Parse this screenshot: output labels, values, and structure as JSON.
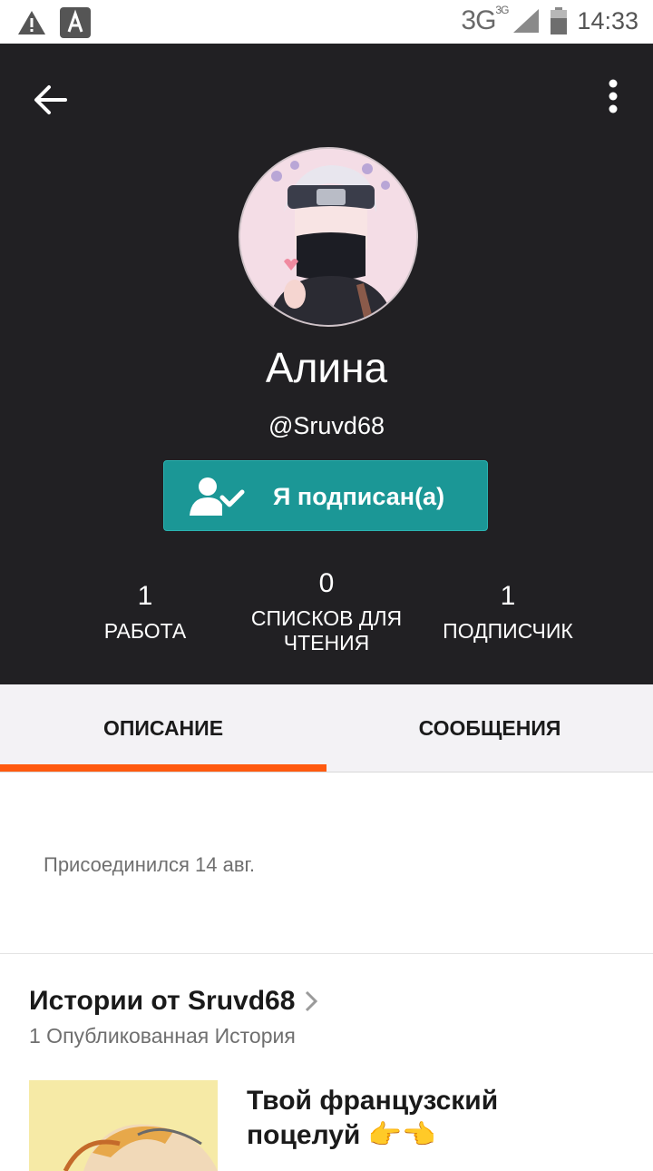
{
  "status_bar": {
    "network": "3G",
    "network_sup": "3G",
    "time": "14:33"
  },
  "profile": {
    "name": "Алина",
    "handle": "@Sruvd68",
    "follow_button_label": "Я подписан(а)"
  },
  "stats": [
    {
      "value": "1",
      "label": "РАБОТА"
    },
    {
      "value": "0",
      "label_line1": "СПИСКОВ ДЛЯ",
      "label_line2": "ЧТЕНИЯ"
    },
    {
      "value": "1",
      "label": "ПОДПИСЧИК"
    }
  ],
  "tabs": [
    {
      "label": "ОПИСАНИЕ",
      "active": true
    },
    {
      "label": "СООБЩЕНИЯ",
      "active": false
    }
  ],
  "description": {
    "joined": "Присоединился 14 авг."
  },
  "stories": {
    "title": "Истории от Sruvd68",
    "subtitle": "1 Опубликованная История",
    "items": [
      {
        "title": "Твой французский поцелуй 👉👈"
      }
    ]
  },
  "colors": {
    "header_bg": "#212023",
    "follow_button": "#1b9796",
    "tab_indicator": "#ff5a0f"
  },
  "icons": [
    "warning-icon",
    "app-notification-icon",
    "signal-icon",
    "battery-icon",
    "back-arrow-icon",
    "more-vertical-icon",
    "user-check-icon",
    "chevron-right-icon"
  ]
}
